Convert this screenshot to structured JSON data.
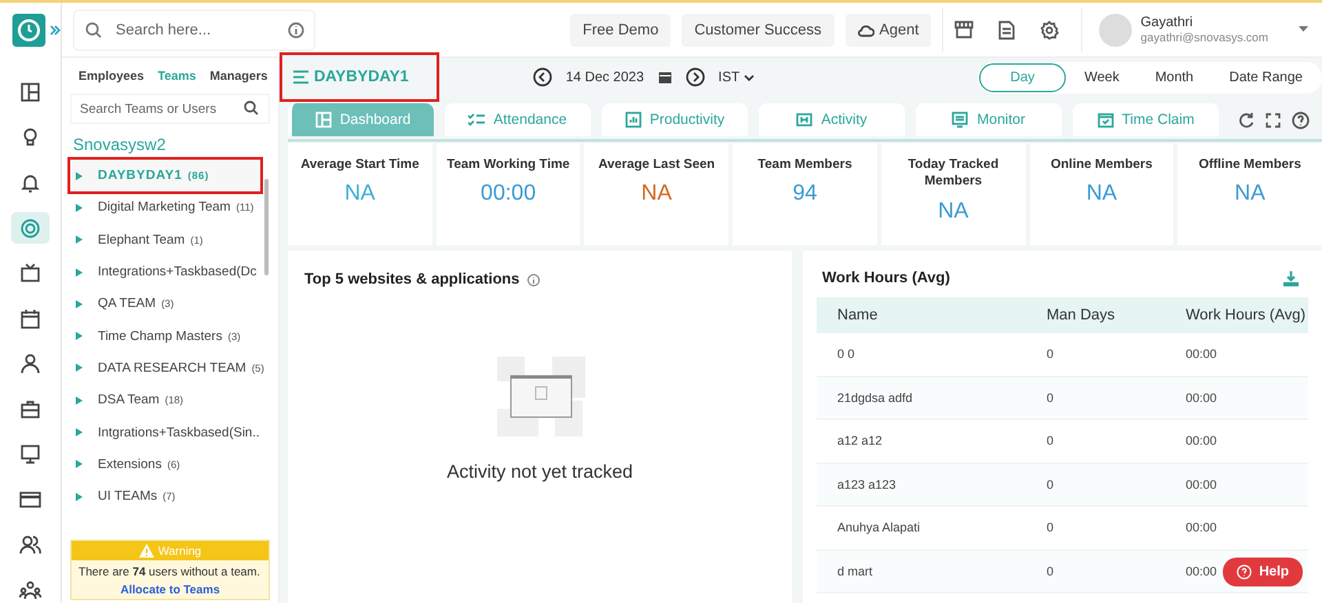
{
  "top_bar": {
    "search": {
      "placeholder": "Search here..."
    },
    "buttons": [
      "Free Demo",
      "Customer Success",
      "Agent"
    ],
    "user": {
      "name": "Gayathri",
      "email": "gayathri@snovasys.com"
    }
  },
  "sidebar": {
    "tabs": [
      {
        "label": "Employees",
        "selected": false
      },
      {
        "label": "Teams",
        "selected": true
      },
      {
        "label": "Managers",
        "selected": false
      }
    ],
    "search": {
      "placeholder": "Search Teams or Users"
    },
    "organization": "Snovasysw2",
    "teams": [
      {
        "name": "DAYBYDAY1",
        "count": "(86)",
        "selected": true,
        "highlighted": true
      },
      {
        "name": "Digital Marketing Team",
        "count": "(11)",
        "selected": false,
        "highlighted": false
      },
      {
        "name": "Elephant Team",
        "count": "(1)",
        "selected": false,
        "highlighted": false
      },
      {
        "name": "Integrations+Taskbased(Dc",
        "selected": false,
        "highlighted": false
      },
      {
        "name": "QA TEAM",
        "count": "(3)",
        "selected": false,
        "highlighted": false
      },
      {
        "name": "Time Champ Masters",
        "count": "(3)",
        "selected": false,
        "highlighted": false
      },
      {
        "name": "DATA RESEARCH TEAM",
        "count": "(5)",
        "selected": false,
        "highlighted": false
      },
      {
        "name": "DSA Team",
        "count": "(18)",
        "selected": false,
        "highlighted": false
      },
      {
        "name": "Intgrations+Taskbased(Sin..",
        "selected": false,
        "highlighted": false
      },
      {
        "name": "Extensions",
        "count": "(6)",
        "selected": false,
        "highlighted": false
      },
      {
        "name": "UI TEAMs",
        "count": "(7)",
        "selected": false,
        "highlighted": false
      }
    ],
    "warning": {
      "title": "Warning",
      "message": "There are **74** users without a team.",
      "link": "Allocate to Teams"
    }
  },
  "header": {
    "title": "DAYBYDAY1",
    "title_highlighted": true,
    "date": "14 Dec 2023",
    "timezone": "IST",
    "periods": [
      {
        "label": "Day",
        "selected": true
      },
      {
        "label": "Week",
        "selected": false
      },
      {
        "label": "Month",
        "selected": false
      },
      {
        "label": "Date Range",
        "selected": false
      }
    ]
  },
  "tabs": [
    {
      "label": "Dashboard",
      "selected": true
    },
    {
      "label": "Attendance",
      "selected": false
    },
    {
      "label": "Productivity",
      "selected": false
    },
    {
      "label": "Activity",
      "selected": false
    },
    {
      "label": "Monitor",
      "selected": false
    },
    {
      "label": "Time Claim",
      "selected": false
    }
  ],
  "stats": [
    {
      "label": "Average Start Time",
      "value": "NA",
      "color": "#3bb0d9"
    },
    {
      "label": "Team Working Time",
      "value": "00:00",
      "color": "#3a9bd5"
    },
    {
      "label": "Average Last Seen",
      "value": "NA",
      "color": "#d2691e"
    },
    {
      "label": "Team Members",
      "value": "94",
      "color": "#3a9bd5"
    },
    {
      "label": "Today Tracked Members",
      "value": "NA",
      "color": "#3a9bd5"
    },
    {
      "label": "Online Members",
      "value": "NA",
      "color": "#3a9bd5"
    },
    {
      "label": "Offline Members",
      "value": "NA",
      "color": "#3a9bd5"
    }
  ],
  "top_apps": {
    "title": "Top 5 websites & applications",
    "empty_message": "Activity not yet tracked"
  },
  "work_hours": {
    "title": "Work Hours (Avg)",
    "columns": [
      "Name",
      "Man Days",
      "Work Hours (Avg)"
    ],
    "rows": [
      [
        "0 0",
        "0",
        "00:00"
      ],
      [
        "21dgdsa adfd",
        "0",
        "00:00"
      ],
      [
        "a12 a12",
        "0",
        "00:00"
      ],
      [
        "a123 a123",
        "0",
        "00:00"
      ],
      [
        "Anuhya Alapati",
        "0",
        "00:00"
      ],
      [
        "d mart",
        "0",
        "00:00"
      ]
    ]
  },
  "help_button": "Help"
}
